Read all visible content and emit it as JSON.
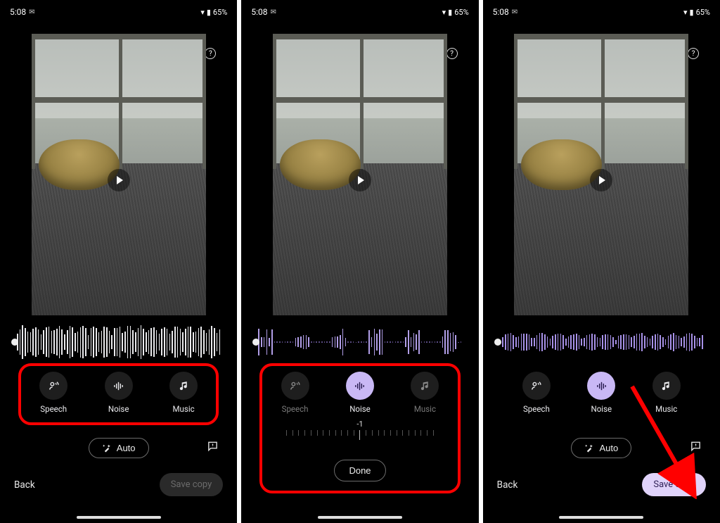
{
  "status": {
    "time": "5:08",
    "battery": "65%"
  },
  "controls": {
    "speech": "Speech",
    "noise": "Noise",
    "music": "Music",
    "auto": "Auto",
    "back": "Back",
    "save": "Save copy",
    "done": "Done"
  },
  "slider": {
    "value": "-1"
  },
  "panel3": {
    "noise_active": true,
    "save_enabled": true
  }
}
